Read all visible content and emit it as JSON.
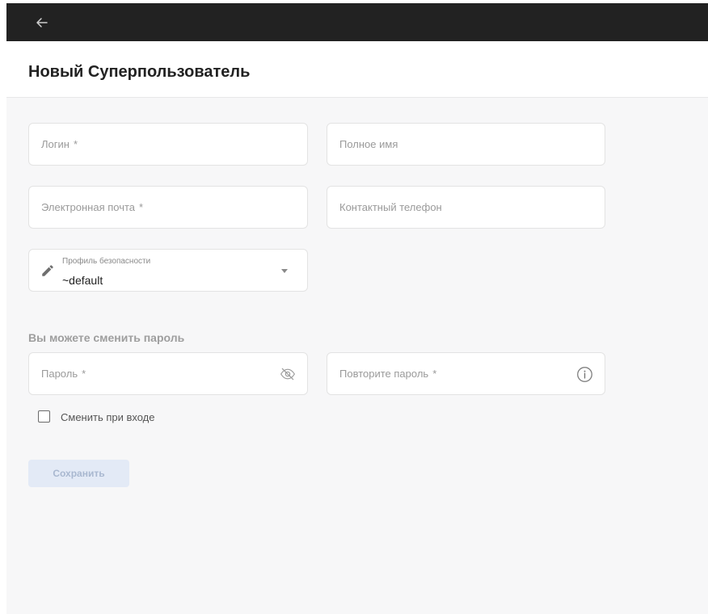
{
  "page": {
    "title": "Новый Суперпользователь"
  },
  "form": {
    "login": {
      "label": "Логин",
      "required_mark": "*"
    },
    "full_name": {
      "label": "Полное имя"
    },
    "email": {
      "label": "Электронная почта",
      "required_mark": "*"
    },
    "phone": {
      "label": "Контактный телефон"
    },
    "security_profile": {
      "label": "Профиль безопасности",
      "value": "~default"
    },
    "password_section_title": "Вы можете сменить пароль",
    "password": {
      "label": "Пароль",
      "required_mark": "*"
    },
    "repeat_password": {
      "label": "Повторите пароль",
      "required_mark": "*"
    },
    "change_on_login": {
      "label": "Сменить при входе",
      "checked": false
    },
    "save_label": "Сохранить"
  },
  "icons": {
    "back": "arrow-left-icon",
    "pencil": "pencil-icon",
    "dropdown": "chevron-down-icon",
    "password_visibility": "eye-off-icon",
    "info": "info-icon"
  }
}
